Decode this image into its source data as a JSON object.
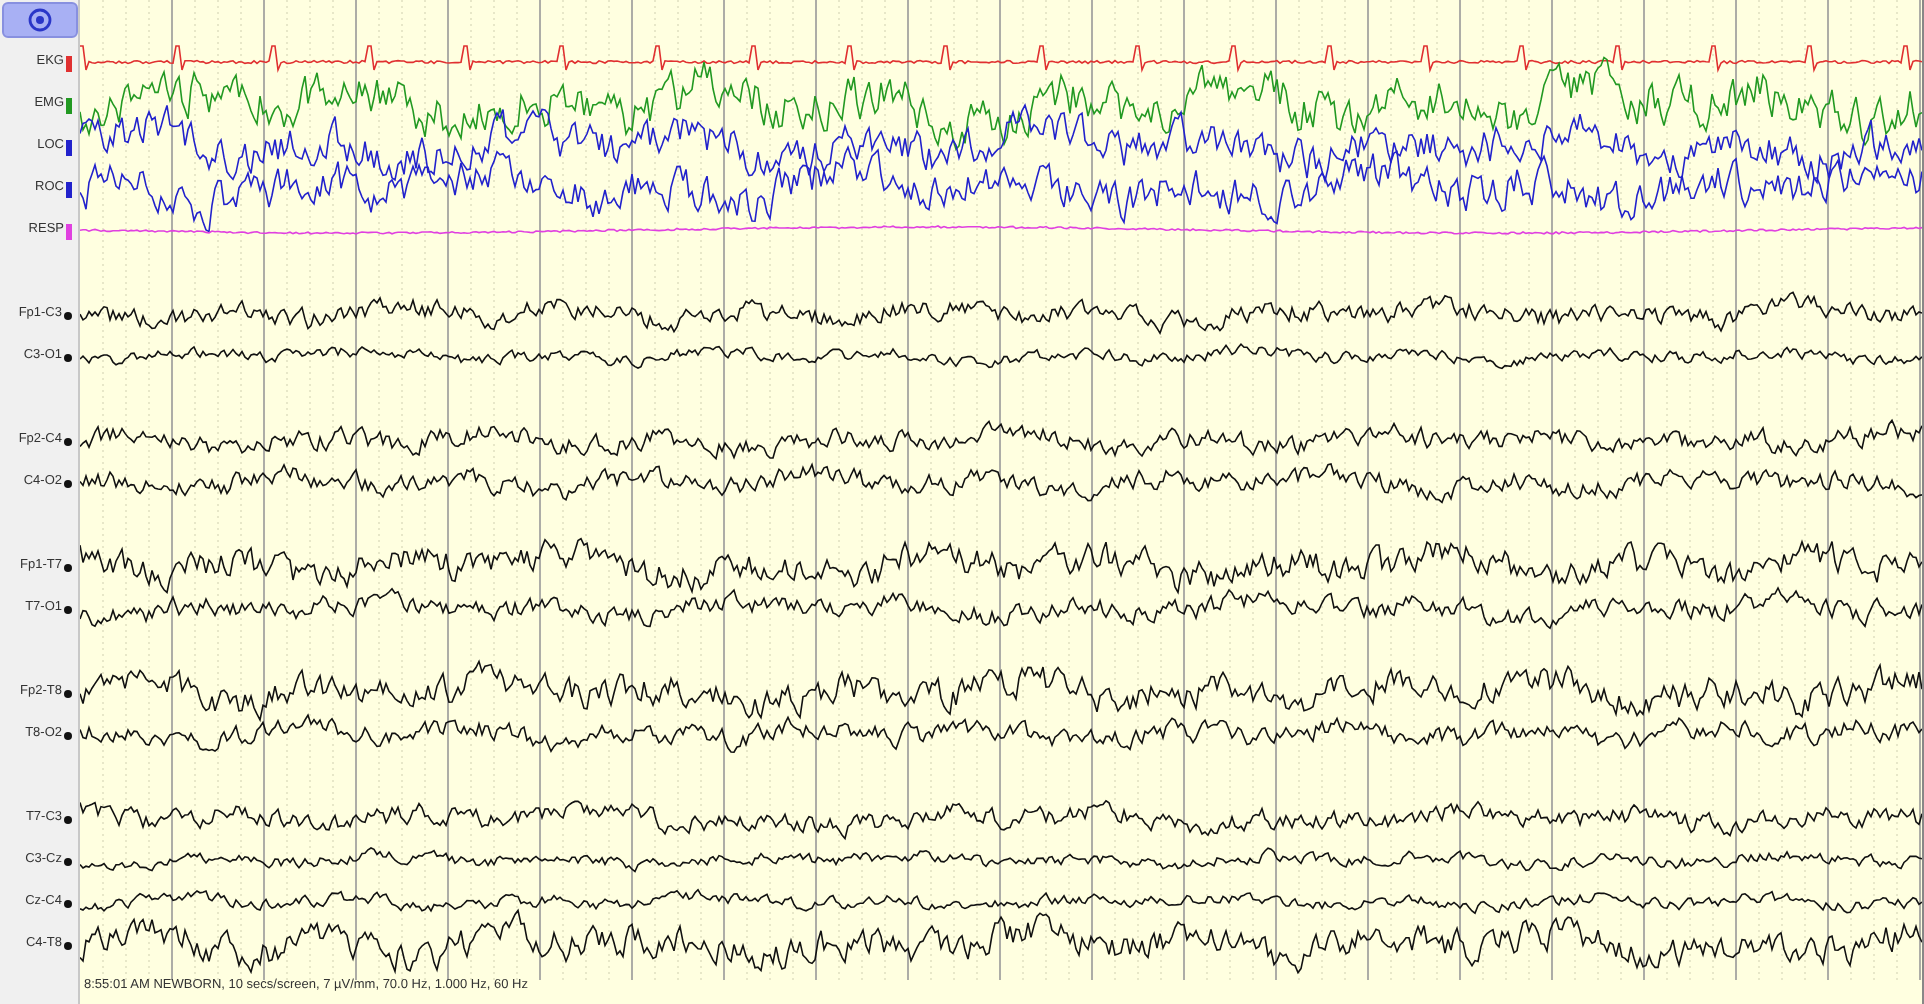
{
  "toolbar": {
    "button": {
      "selected": true
    }
  },
  "channels": [
    {
      "label": "EKG",
      "kind": "ekg",
      "color": "#e03030"
    },
    {
      "label": "EMG",
      "kind": "emg",
      "color": "#229922"
    },
    {
      "label": "LOC",
      "kind": "eog",
      "color": "#2222cc"
    },
    {
      "label": "ROC",
      "kind": "eog",
      "color": "#2222cc"
    },
    {
      "label": "RESP",
      "kind": "resp",
      "color": "#e040e0"
    },
    {
      "kind": "spacer"
    },
    {
      "label": "Fp1-C3",
      "kind": "eeg",
      "color": "#111111"
    },
    {
      "label": "C3-O1",
      "kind": "eeg-low",
      "color": "#111111"
    },
    {
      "kind": "spacer"
    },
    {
      "label": "Fp2-C4",
      "kind": "eeg",
      "color": "#111111"
    },
    {
      "label": "C4-O2",
      "kind": "eeg",
      "color": "#111111"
    },
    {
      "kind": "spacer"
    },
    {
      "label": "Fp1-T7",
      "kind": "eeg-high",
      "color": "#111111"
    },
    {
      "label": "T7-O1",
      "kind": "eeg",
      "color": "#111111"
    },
    {
      "kind": "spacer"
    },
    {
      "label": "Fp2-T8",
      "kind": "eeg-high",
      "color": "#111111"
    },
    {
      "label": "T8-O2",
      "kind": "eeg",
      "color": "#111111"
    },
    {
      "kind": "spacer"
    },
    {
      "label": "T7-C3",
      "kind": "eeg",
      "color": "#111111"
    },
    {
      "label": "C3-Cz",
      "kind": "eeg-low",
      "color": "#111111"
    },
    {
      "label": "Cz-C4",
      "kind": "eeg-low",
      "color": "#111111"
    },
    {
      "label": "C4-T8",
      "kind": "eeg-high",
      "color": "#111111"
    }
  ],
  "status_bar": "8:55:01 AM NEWBORN, 10 secs/screen, 7 µV/mm, 70.0 Hz, 1.000 Hz, 60 Hz"
}
